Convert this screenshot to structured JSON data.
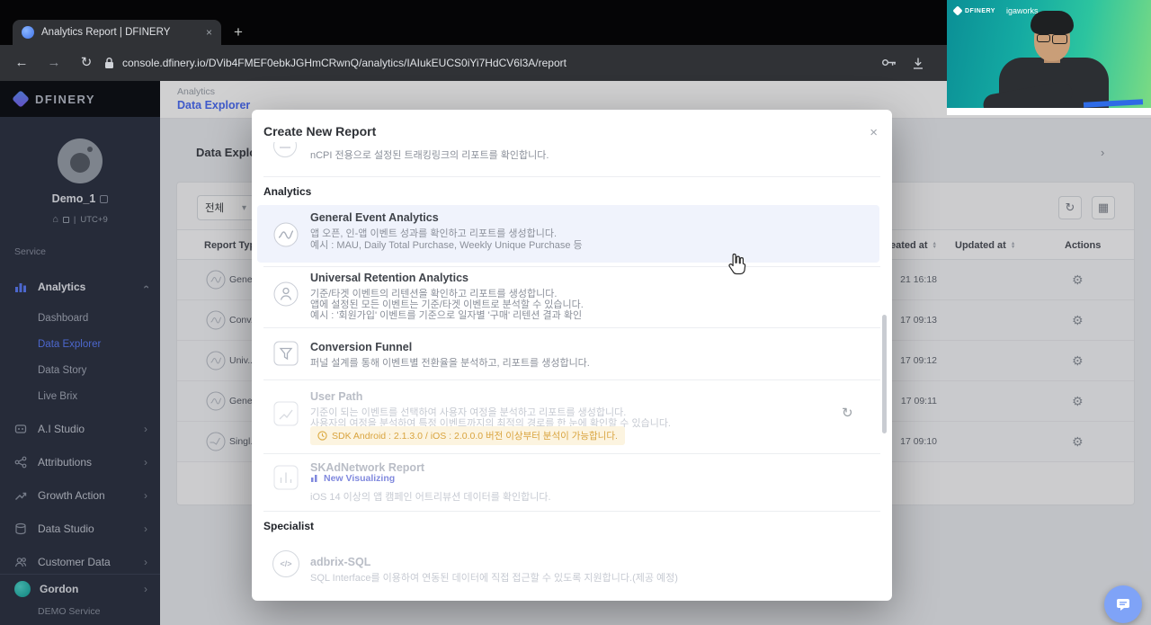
{
  "browser": {
    "tab_title": "Analytics Report | DFINERY",
    "url": "console.dfinery.io/DVib4FMEF0ebkJGHmCRwnQ/analytics/IAIukEUCS0iYi7HdCV6l3A/report"
  },
  "webcam": {
    "brand": "DFINERY",
    "partner": "igaworks"
  },
  "sidebar": {
    "logo_text": "DFINERY",
    "user_name": "Demo_1",
    "timezone": "UTC+9",
    "section_label": "Service",
    "nav_analytics": "Analytics",
    "analytics_children": [
      "Dashboard",
      "Data Explorer",
      "Data Story",
      "Live Brix"
    ],
    "nav_items": [
      "A.I Studio",
      "Attributions",
      "Growth Action",
      "Data Studio",
      "Customer Data"
    ],
    "workspace_name": "Gordon",
    "workspace_service": "DEMO Service"
  },
  "header": {
    "breadcrumb": "Analytics",
    "page": "Data Explorer"
  },
  "content": {
    "title": "Data Explorer",
    "filter_value": "전체",
    "table_headers": {
      "type": "Report Type",
      "created": "Created at",
      "updated": "Updated at",
      "actions": "Actions"
    },
    "rows": [
      {
        "name": "Gene...",
        "created": "21 16:18"
      },
      {
        "name": "Conv...",
        "created": "17 09:13"
      },
      {
        "name": "Univ...",
        "created": "17 09:12"
      },
      {
        "name": "Gene...",
        "created": "17 09:11"
      },
      {
        "name": "Singl...",
        "created": "17 09:10"
      }
    ]
  },
  "modal": {
    "title": "Create New Report",
    "partial_desc": "nCPI 전용으로 설정된 트래킹링크의 리포트를 확인합니다.",
    "section_analytics": "Analytics",
    "section_specialist": "Specialist",
    "items": [
      {
        "title": "General Event Analytics",
        "desc": [
          "앱 오픈, 인-앱 이벤트 성과를 확인하고 리포트를 생성합니다.",
          "예시 : MAU, Daily Total Purchase, Weekly Unique Purchase 등"
        ]
      },
      {
        "title": "Universal Retention Analytics",
        "desc": [
          "기준/타겟 이벤트의 리텐션을 확인하고 리포트를 생성합니다.",
          "앱에 설정된 모든 이벤트는 기준/타겟 이벤트로 분석할 수 있습니다.",
          "예시 : '회원가입' 이벤트를 기준으로 일자별 '구매' 리텐션 결과 확인"
        ]
      },
      {
        "title": "Conversion Funnel",
        "desc": [
          "퍼널 설계를 통해 이벤트별 전환율을 분석하고, 리포트를 생성합니다."
        ]
      },
      {
        "title": "User Path",
        "desc": [
          "기준이 되는 이벤트를 선택하여 사용자 여정을 분석하고 리포트를 생성합니다.",
          "사용자의 여정을 분석하여 특정 이벤트까지의 최적의 경로를 한 눈에 확인할 수 있습니다."
        ],
        "sdk_notice": "SDK Android : 2.1.3.0 / iOS : 2.0.0.0 버전 이상부터 분석이 가능합니다."
      },
      {
        "title": "SKAdNetwork Report",
        "badge": "New Visualizing",
        "desc": [
          "iOS 14 이상의 앱 캠페인 어트리뷰션 데이터를 확인합니다."
        ]
      },
      {
        "title": "adbrix-SQL",
        "desc": [
          "SQL Interface를 이용하여 연동된 데이터에 직접 접근할 수 있도록 지원합니다.(제공 예정)"
        ]
      }
    ]
  },
  "icons": {
    "close": "×",
    "new_tab": "+",
    "back": "←",
    "forward": "→",
    "reload": "↻",
    "caret_down": "▾",
    "chevron": "›",
    "gear": "⚙",
    "grid": "▦",
    "refresh": "↻",
    "sort_up": "▲",
    "sort_down": "▼",
    "home": "⌂",
    "sync": "↻",
    "code": "</>"
  },
  "colors": {
    "accent": "#4a6cf7",
    "sidebar_bg": "#2b3142",
    "modal_highlight": "#f0f3fc",
    "warning_text": "#d9a43f",
    "badge_blue": "#8089de",
    "workspace_teal": "#18b8ae",
    "webcam_teal": "#14aaa2"
  }
}
